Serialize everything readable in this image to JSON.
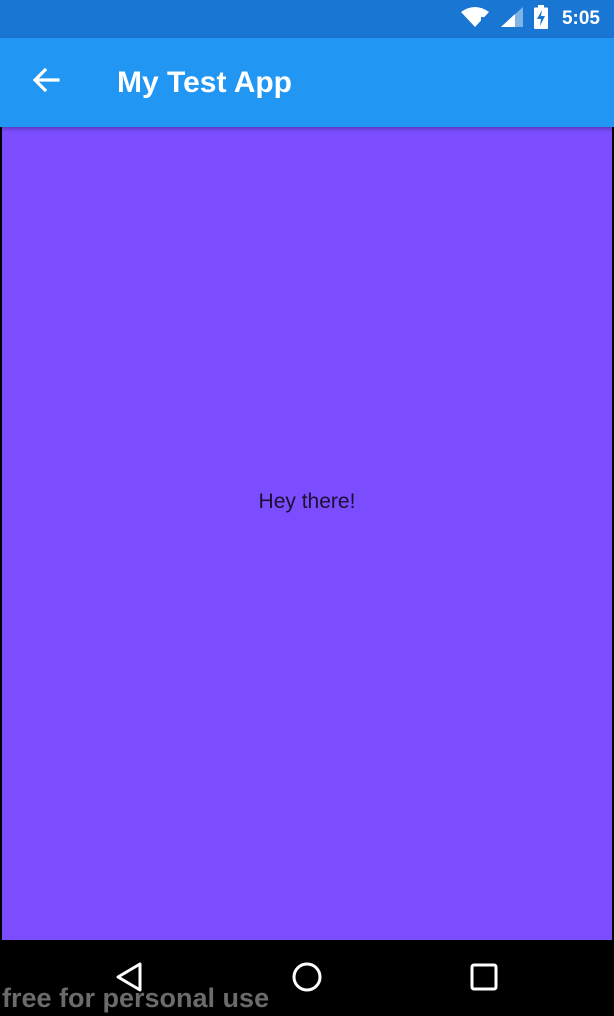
{
  "status_bar": {
    "time": "5:05",
    "icons": [
      "wifi-icon",
      "signal-icon",
      "battery-charging-icon"
    ]
  },
  "app_bar": {
    "title": "My Test App",
    "back_icon": "arrow-back-icon"
  },
  "content": {
    "message": "Hey there!"
  },
  "nav_bar": {
    "buttons": [
      "back-triangle-icon",
      "home-circle-icon",
      "recents-square-icon"
    ]
  },
  "watermark": {
    "text": "free for personal use"
  },
  "colors": {
    "status_bar": "#1976D2",
    "app_bar": "#2196F3",
    "content_background": "#7C4DFF",
    "nav_bar": "#000000"
  }
}
